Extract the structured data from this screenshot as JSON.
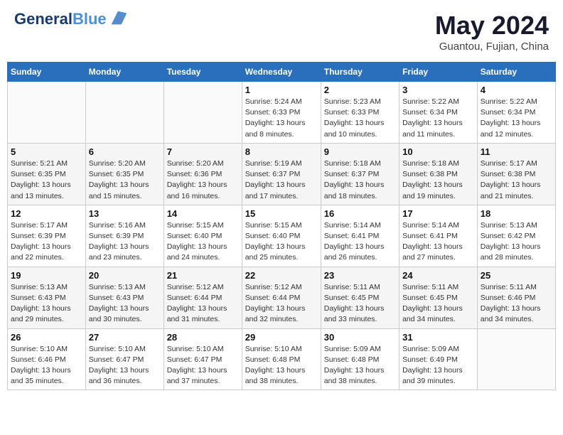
{
  "logo": {
    "line1": "General",
    "line2": "Blue"
  },
  "title": "May 2024",
  "location": "Guantou, Fujian, China",
  "weekdays": [
    "Sunday",
    "Monday",
    "Tuesday",
    "Wednesday",
    "Thursday",
    "Friday",
    "Saturday"
  ],
  "weeks": [
    [
      {
        "day": "",
        "sunrise": "",
        "sunset": "",
        "daylight": ""
      },
      {
        "day": "",
        "sunrise": "",
        "sunset": "",
        "daylight": ""
      },
      {
        "day": "",
        "sunrise": "",
        "sunset": "",
        "daylight": ""
      },
      {
        "day": "1",
        "sunrise": "Sunrise: 5:24 AM",
        "sunset": "Sunset: 6:33 PM",
        "daylight": "Daylight: 13 hours and 8 minutes."
      },
      {
        "day": "2",
        "sunrise": "Sunrise: 5:23 AM",
        "sunset": "Sunset: 6:33 PM",
        "daylight": "Daylight: 13 hours and 10 minutes."
      },
      {
        "day": "3",
        "sunrise": "Sunrise: 5:22 AM",
        "sunset": "Sunset: 6:34 PM",
        "daylight": "Daylight: 13 hours and 11 minutes."
      },
      {
        "day": "4",
        "sunrise": "Sunrise: 5:22 AM",
        "sunset": "Sunset: 6:34 PM",
        "daylight": "Daylight: 13 hours and 12 minutes."
      }
    ],
    [
      {
        "day": "5",
        "sunrise": "Sunrise: 5:21 AM",
        "sunset": "Sunset: 6:35 PM",
        "daylight": "Daylight: 13 hours and 13 minutes."
      },
      {
        "day": "6",
        "sunrise": "Sunrise: 5:20 AM",
        "sunset": "Sunset: 6:35 PM",
        "daylight": "Daylight: 13 hours and 15 minutes."
      },
      {
        "day": "7",
        "sunrise": "Sunrise: 5:20 AM",
        "sunset": "Sunset: 6:36 PM",
        "daylight": "Daylight: 13 hours and 16 minutes."
      },
      {
        "day": "8",
        "sunrise": "Sunrise: 5:19 AM",
        "sunset": "Sunset: 6:37 PM",
        "daylight": "Daylight: 13 hours and 17 minutes."
      },
      {
        "day": "9",
        "sunrise": "Sunrise: 5:18 AM",
        "sunset": "Sunset: 6:37 PM",
        "daylight": "Daylight: 13 hours and 18 minutes."
      },
      {
        "day": "10",
        "sunrise": "Sunrise: 5:18 AM",
        "sunset": "Sunset: 6:38 PM",
        "daylight": "Daylight: 13 hours and 19 minutes."
      },
      {
        "day": "11",
        "sunrise": "Sunrise: 5:17 AM",
        "sunset": "Sunset: 6:38 PM",
        "daylight": "Daylight: 13 hours and 21 minutes."
      }
    ],
    [
      {
        "day": "12",
        "sunrise": "Sunrise: 5:17 AM",
        "sunset": "Sunset: 6:39 PM",
        "daylight": "Daylight: 13 hours and 22 minutes."
      },
      {
        "day": "13",
        "sunrise": "Sunrise: 5:16 AM",
        "sunset": "Sunset: 6:39 PM",
        "daylight": "Daylight: 13 hours and 23 minutes."
      },
      {
        "day": "14",
        "sunrise": "Sunrise: 5:15 AM",
        "sunset": "Sunset: 6:40 PM",
        "daylight": "Daylight: 13 hours and 24 minutes."
      },
      {
        "day": "15",
        "sunrise": "Sunrise: 5:15 AM",
        "sunset": "Sunset: 6:40 PM",
        "daylight": "Daylight: 13 hours and 25 minutes."
      },
      {
        "day": "16",
        "sunrise": "Sunrise: 5:14 AM",
        "sunset": "Sunset: 6:41 PM",
        "daylight": "Daylight: 13 hours and 26 minutes."
      },
      {
        "day": "17",
        "sunrise": "Sunrise: 5:14 AM",
        "sunset": "Sunset: 6:41 PM",
        "daylight": "Daylight: 13 hours and 27 minutes."
      },
      {
        "day": "18",
        "sunrise": "Sunrise: 5:13 AM",
        "sunset": "Sunset: 6:42 PM",
        "daylight": "Daylight: 13 hours and 28 minutes."
      }
    ],
    [
      {
        "day": "19",
        "sunrise": "Sunrise: 5:13 AM",
        "sunset": "Sunset: 6:43 PM",
        "daylight": "Daylight: 13 hours and 29 minutes."
      },
      {
        "day": "20",
        "sunrise": "Sunrise: 5:13 AM",
        "sunset": "Sunset: 6:43 PM",
        "daylight": "Daylight: 13 hours and 30 minutes."
      },
      {
        "day": "21",
        "sunrise": "Sunrise: 5:12 AM",
        "sunset": "Sunset: 6:44 PM",
        "daylight": "Daylight: 13 hours and 31 minutes."
      },
      {
        "day": "22",
        "sunrise": "Sunrise: 5:12 AM",
        "sunset": "Sunset: 6:44 PM",
        "daylight": "Daylight: 13 hours and 32 minutes."
      },
      {
        "day": "23",
        "sunrise": "Sunrise: 5:11 AM",
        "sunset": "Sunset: 6:45 PM",
        "daylight": "Daylight: 13 hours and 33 minutes."
      },
      {
        "day": "24",
        "sunrise": "Sunrise: 5:11 AM",
        "sunset": "Sunset: 6:45 PM",
        "daylight": "Daylight: 13 hours and 34 minutes."
      },
      {
        "day": "25",
        "sunrise": "Sunrise: 5:11 AM",
        "sunset": "Sunset: 6:46 PM",
        "daylight": "Daylight: 13 hours and 34 minutes."
      }
    ],
    [
      {
        "day": "26",
        "sunrise": "Sunrise: 5:10 AM",
        "sunset": "Sunset: 6:46 PM",
        "daylight": "Daylight: 13 hours and 35 minutes."
      },
      {
        "day": "27",
        "sunrise": "Sunrise: 5:10 AM",
        "sunset": "Sunset: 6:47 PM",
        "daylight": "Daylight: 13 hours and 36 minutes."
      },
      {
        "day": "28",
        "sunrise": "Sunrise: 5:10 AM",
        "sunset": "Sunset: 6:47 PM",
        "daylight": "Daylight: 13 hours and 37 minutes."
      },
      {
        "day": "29",
        "sunrise": "Sunrise: 5:10 AM",
        "sunset": "Sunset: 6:48 PM",
        "daylight": "Daylight: 13 hours and 38 minutes."
      },
      {
        "day": "30",
        "sunrise": "Sunrise: 5:09 AM",
        "sunset": "Sunset: 6:48 PM",
        "daylight": "Daylight: 13 hours and 38 minutes."
      },
      {
        "day": "31",
        "sunrise": "Sunrise: 5:09 AM",
        "sunset": "Sunset: 6:49 PM",
        "daylight": "Daylight: 13 hours and 39 minutes."
      },
      {
        "day": "",
        "sunrise": "",
        "sunset": "",
        "daylight": ""
      }
    ]
  ]
}
